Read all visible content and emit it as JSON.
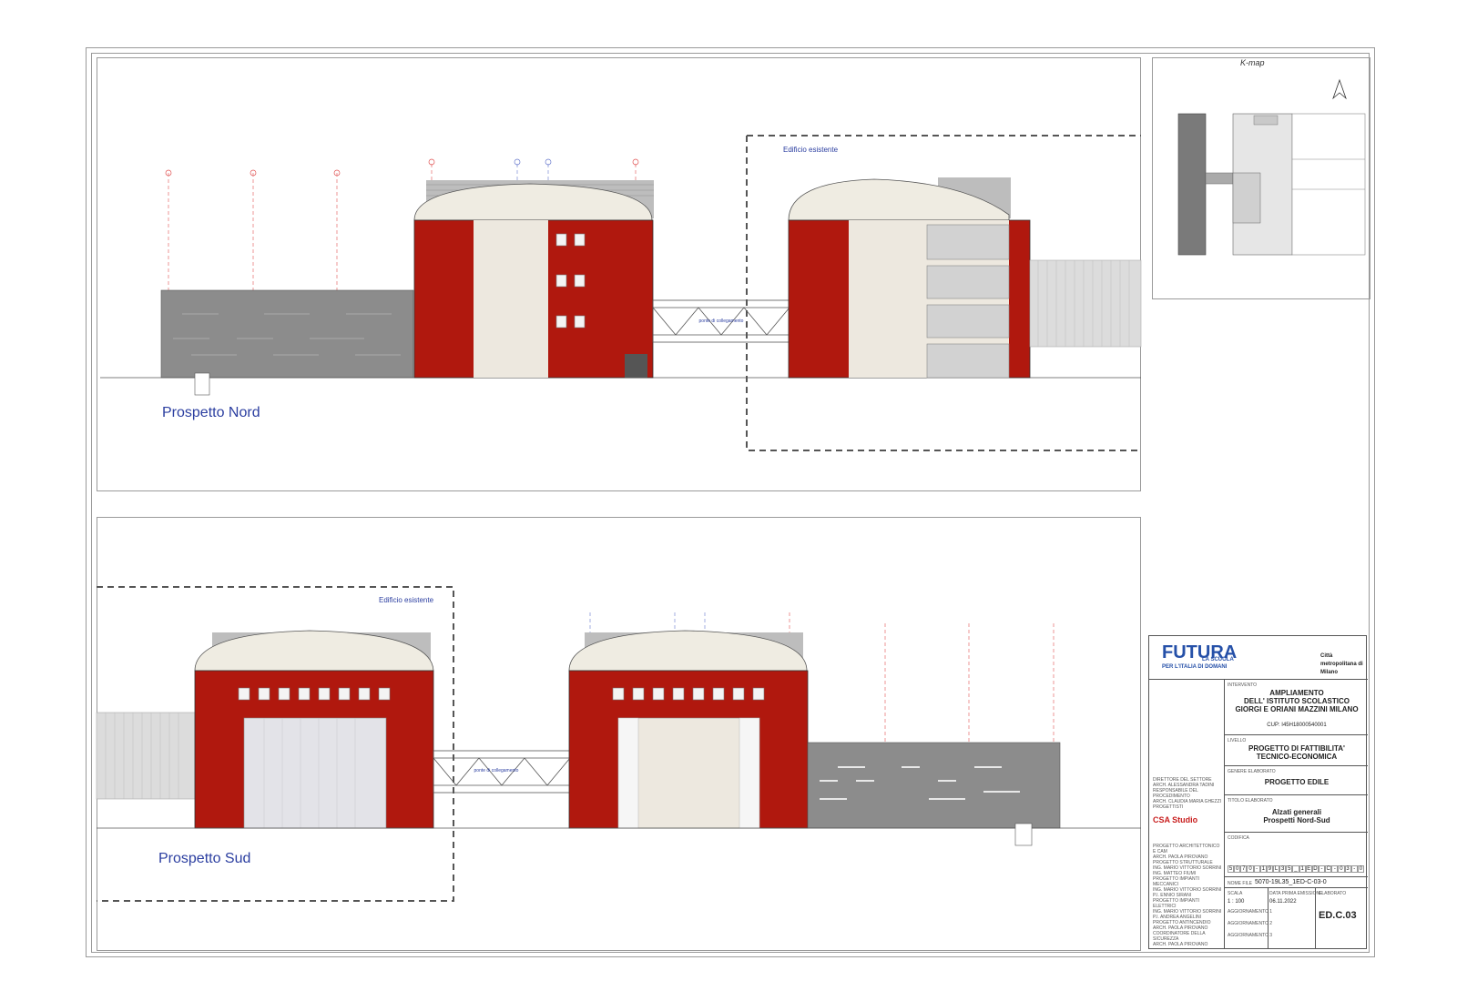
{
  "colors": {
    "brick": "#b0180e",
    "render": "#ede8df",
    "cladding": "#8c8c8c",
    "existing_frame": "#555555",
    "title_blue": "#2b3ea0"
  },
  "north": {
    "title": "Prospetto Nord",
    "existing_label": "Edificio esistente",
    "bridge_label": "ponte di collegamento"
  },
  "south": {
    "title": "Prospetto Sud",
    "existing_label": "Edificio esistente",
    "bridge_label": "ponte di collegamento"
  },
  "kmap": {
    "title": "K-map"
  },
  "titleblock": {
    "logo_main": "FUTURA",
    "logo_sub1": "LA SCUOLA",
    "logo_sub2": "PER L'ITALIA DI DOMANI",
    "metro_label": "Città metropolitana di Milano",
    "intervento_label": "INTERVENTO",
    "project_lines": [
      "AMPLIAMENTO",
      "DELL' ISTITUTO SCOLASTICO",
      "GIORGI E ORIANI MAZZINI MILANO"
    ],
    "cup": "CUP: I45H18000540001",
    "livello_label": "LIVELLO",
    "livello_lines": [
      "PROGETTO DI FATTIBILITA'",
      "TECNICO-ECONOMICA"
    ],
    "genere_label": "GENERE ELABORATO",
    "genere": "PROGETTO EDILE",
    "titolo_label": "TITOLO ELABORATO",
    "titolo_lines": [
      "Alzati generali",
      "Prospetti Nord-Sud"
    ],
    "codifica_label": "CODIFICA",
    "code_chars": [
      "5",
      "0",
      "7",
      "0",
      "-",
      "1",
      "9",
      "L",
      "3",
      "5",
      "_",
      "1",
      "E",
      "D",
      "-",
      "C",
      "-",
      "0",
      "3",
      "-",
      "0"
    ],
    "nome_file_label": "NOME FILE",
    "nome_file": "5070-19L35_1ED-C-03-0",
    "scala_label": "SCALA",
    "scala": "1 : 100",
    "data_label": "DATA PRIMA EMISSIONE",
    "data": "06.11.2022",
    "elaborato_label": "ELABORATO",
    "elaborato": "ED.C.03",
    "agg": [
      "Aggiornamento 1",
      "Aggiornamento 2",
      "Aggiornamento 3"
    ],
    "studio": "CSA Studio",
    "left_notes": [
      "Direttore del settore",
      "Arch. Alessandra Tadini",
      "Responsabile del procedimento",
      "Arch. Claudia Maria Ghezzi",
      "Progettisti",
      "Progetto architettonico e CAM",
      "arch. Paola Pirovano",
      "Progetto Strutturale",
      "ing. Mario Vittorio Sorrini",
      "ing. Matteo Fiumi",
      "Progetto impianti Meccanici",
      "ing. Mario Vittorio Sorrini",
      "p.i. Ennio Sirani",
      "Progetto impianti Elettrici",
      "ing. Mario Vittorio Sorrini",
      "p.i. Andrea Angelini",
      "Progetto Antincendio",
      "arch. Paola Pirovano",
      "Coordinatore della Sicurezza",
      "arch. Paola Pirovano"
    ]
  }
}
